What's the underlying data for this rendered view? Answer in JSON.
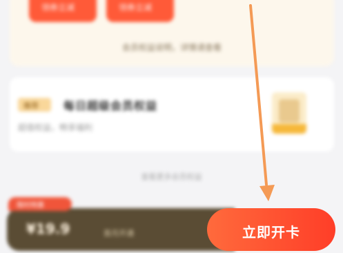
{
  "top_card": {
    "coupon1_text": "领券立减",
    "coupon2_text": "领券立减",
    "note": "会员权益说明，详情请查看"
  },
  "mid_card": {
    "tag": "推荐",
    "title": "每日超级会员权益",
    "subtitle": "超值权益，畅享福利"
  },
  "footnote": "查看更多会员权益",
  "bottom_bar": {
    "badge": "限时特惠",
    "price": "¥19.9",
    "price_sub": "首月开通"
  },
  "cta": {
    "label": "立即开卡"
  },
  "colors": {
    "accent": "#ff4a2e",
    "arrow": "#f49a55",
    "bar_dark": "#5a4c34"
  },
  "icons": {
    "arrow": "down-arrow-icon"
  }
}
